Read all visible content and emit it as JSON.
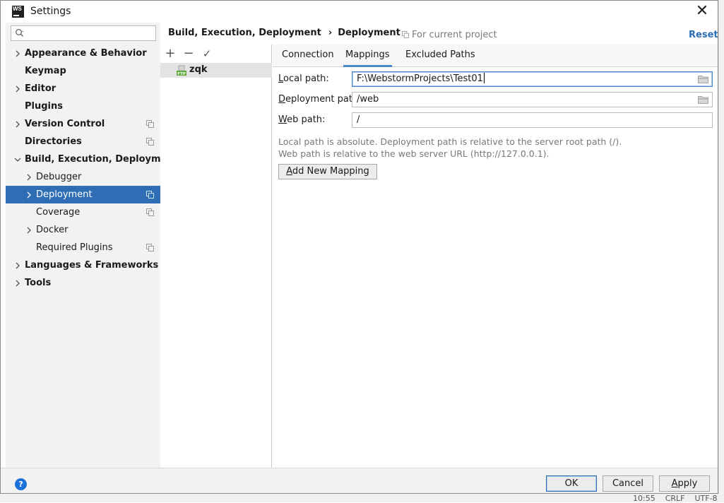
{
  "window": {
    "title": "Settings"
  },
  "search": {
    "placeholder": ""
  },
  "sidebar": {
    "items": [
      {
        "label": "Appearance & Behavior"
      },
      {
        "label": "Keymap"
      },
      {
        "label": "Editor"
      },
      {
        "label": "Plugins"
      },
      {
        "label": "Version Control"
      },
      {
        "label": "Directories"
      },
      {
        "label": "Build, Execution, Deployment"
      },
      {
        "label": "Debugger"
      },
      {
        "label": "Deployment"
      },
      {
        "label": "Coverage"
      },
      {
        "label": "Docker"
      },
      {
        "label": "Required Plugins"
      },
      {
        "label": "Languages & Frameworks"
      },
      {
        "label": "Tools"
      }
    ]
  },
  "header": {
    "breadcrumb_parent": "Build, Execution, Deployment",
    "breadcrumb_sep": "›",
    "breadcrumb_current": "Deployment",
    "scope_text": "For current project",
    "reset_label": "Reset"
  },
  "servers": {
    "toolbar": {
      "add": "+",
      "remove": "−",
      "check": "✓"
    },
    "items": [
      {
        "name": "zqk",
        "icon": "ftp-server-icon"
      }
    ]
  },
  "tabs": [
    {
      "label": "Connection"
    },
    {
      "label": "Mappings"
    },
    {
      "label": "Excluded Paths"
    }
  ],
  "form": {
    "local_path": {
      "label_first": "L",
      "label_rest": "ocal path:",
      "value": "F:\\WebstormProjects\\Test01"
    },
    "deployment_path": {
      "label_first": "D",
      "label_rest": "eployment path:",
      "value": "/web"
    },
    "web_path": {
      "label_first": "W",
      "label_rest": "eb path:",
      "value": "/"
    }
  },
  "hints": {
    "line1": "Local path is absolute. Deployment path is relative to the server root path (/).",
    "line2": "Web path is relative to the web server URL (http://127.0.0.1)."
  },
  "add_mapping": {
    "first": "A",
    "rest": "dd New Mapping"
  },
  "footer": {
    "help": "?",
    "ok": "OK",
    "cancel": "Cancel",
    "apply_first": "A",
    "apply_rest": "pply"
  },
  "background_status": {
    "time": "10:55",
    "line_sep": "CRLF",
    "encoding": "UTF-8"
  },
  "colors": {
    "selection": "#2f6eb5",
    "link": "#2a6cb8",
    "tab_underline": "#4a88c7"
  }
}
